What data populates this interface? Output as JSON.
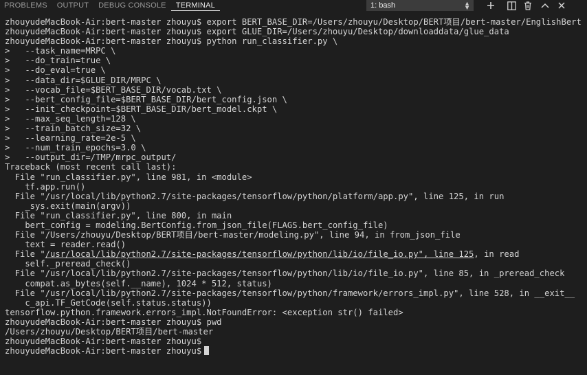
{
  "panel": {
    "tabs": [
      {
        "label": "PROBLEMS"
      },
      {
        "label": "OUTPUT"
      },
      {
        "label": "DEBUG CONSOLE"
      },
      {
        "label": "TERMINAL"
      }
    ],
    "terminal_select": {
      "value": "1: bash"
    },
    "icons": [
      "plus-icon",
      "split-icon",
      "trash-icon",
      "chevron-up-icon",
      "close-icon"
    ]
  },
  "terminal": {
    "lines": [
      "zhouyudeMacBook-Air:bert-master zhouyu$ export BERT_BASE_DIR=/Users/zhouyu/Desktop/BERT项目/bert-master/EnglishBert",
      "zhouyudeMacBook-Air:bert-master zhouyu$ export GLUE_DIR=/Users/zhouyu/Desktop/downloaddata/glue_data",
      "zhouyudeMacBook-Air:bert-master zhouyu$ python run_classifier.py \\",
      ">   --task_name=MRPC \\",
      ">   --do_train=true \\",
      ">   --do_eval=true \\",
      ">   --data_dir=$GLUE_DIR/MRPC \\",
      ">   --vocab_file=$BERT_BASE_DIR/vocab.txt \\",
      ">   --bert_config_file=$BERT_BASE_DIR/bert_config.json \\",
      ">   --init_checkpoint=$BERT_BASE_DIR/bert_model.ckpt \\",
      ">   --max_seq_length=128 \\",
      ">   --train_batch_size=32 \\",
      ">   --learning_rate=2e-5 \\",
      ">   --num_train_epochs=3.0 \\",
      ">   --output_dir=/TMP/mrpc_output/",
      "Traceback (most recent call last):",
      "  File \"run_classifier.py\", line 981, in <module>",
      "    tf.app.run()",
      "  File \"/usr/local/lib/python2.7/site-packages/tensorflow/python/platform/app.py\", line 125, in run",
      "    _sys.exit(main(argv))",
      "  File \"run_classifier.py\", line 800, in main",
      "    bert_config = modeling.BertConfig.from_json_file(FLAGS.bert_config_file)",
      "  File \"/Users/zhouyu/Desktop/BERT项目/bert-master/modeling.py\", line 94, in from_json_file",
      "    text = reader.read()",
      "  File \"/usr/local/lib/python2.7/site-packages/tensorflow/python/lib/io/file_io.py\", line 125, in read",
      "    self._preread_check()",
      "  File \"/usr/local/lib/python2.7/site-packages/tensorflow/python/lib/io/file_io.py\", line 85, in _preread_check",
      "    compat.as_bytes(self.__name), 1024 * 512, status)",
      "  File \"/usr/local/lib/python2.7/site-packages/tensorflow/python/framework/errors_impl.py\", line 528, in __exit__",
      "    c_api.TF_GetCode(self.status.status))",
      "tensorflow.python.framework.errors_impl.NotFoundError: <exception str() failed>",
      "zhouyudeMacBook-Air:bert-master zhouyu$ pwd",
      "/Users/zhouyu/Desktop/BERT项目/bert-master",
      "zhouyudeMacBook-Air:bert-master zhouyu$",
      "zhouyudeMacBook-Air:bert-master zhouyu$"
    ],
    "underlined_line": {
      "pre": "  File \"",
      "link": "/usr/local/lib/python2.7/site-packages/tensorflow/python/lib/io/file_io.py\", line 125",
      "post": ", in read"
    }
  },
  "colors": {
    "background": "#1e1e1e",
    "text": "#d4d4d4",
    "tab_active": "#e7e7e7",
    "tab_inactive": "#9a9a9a"
  }
}
